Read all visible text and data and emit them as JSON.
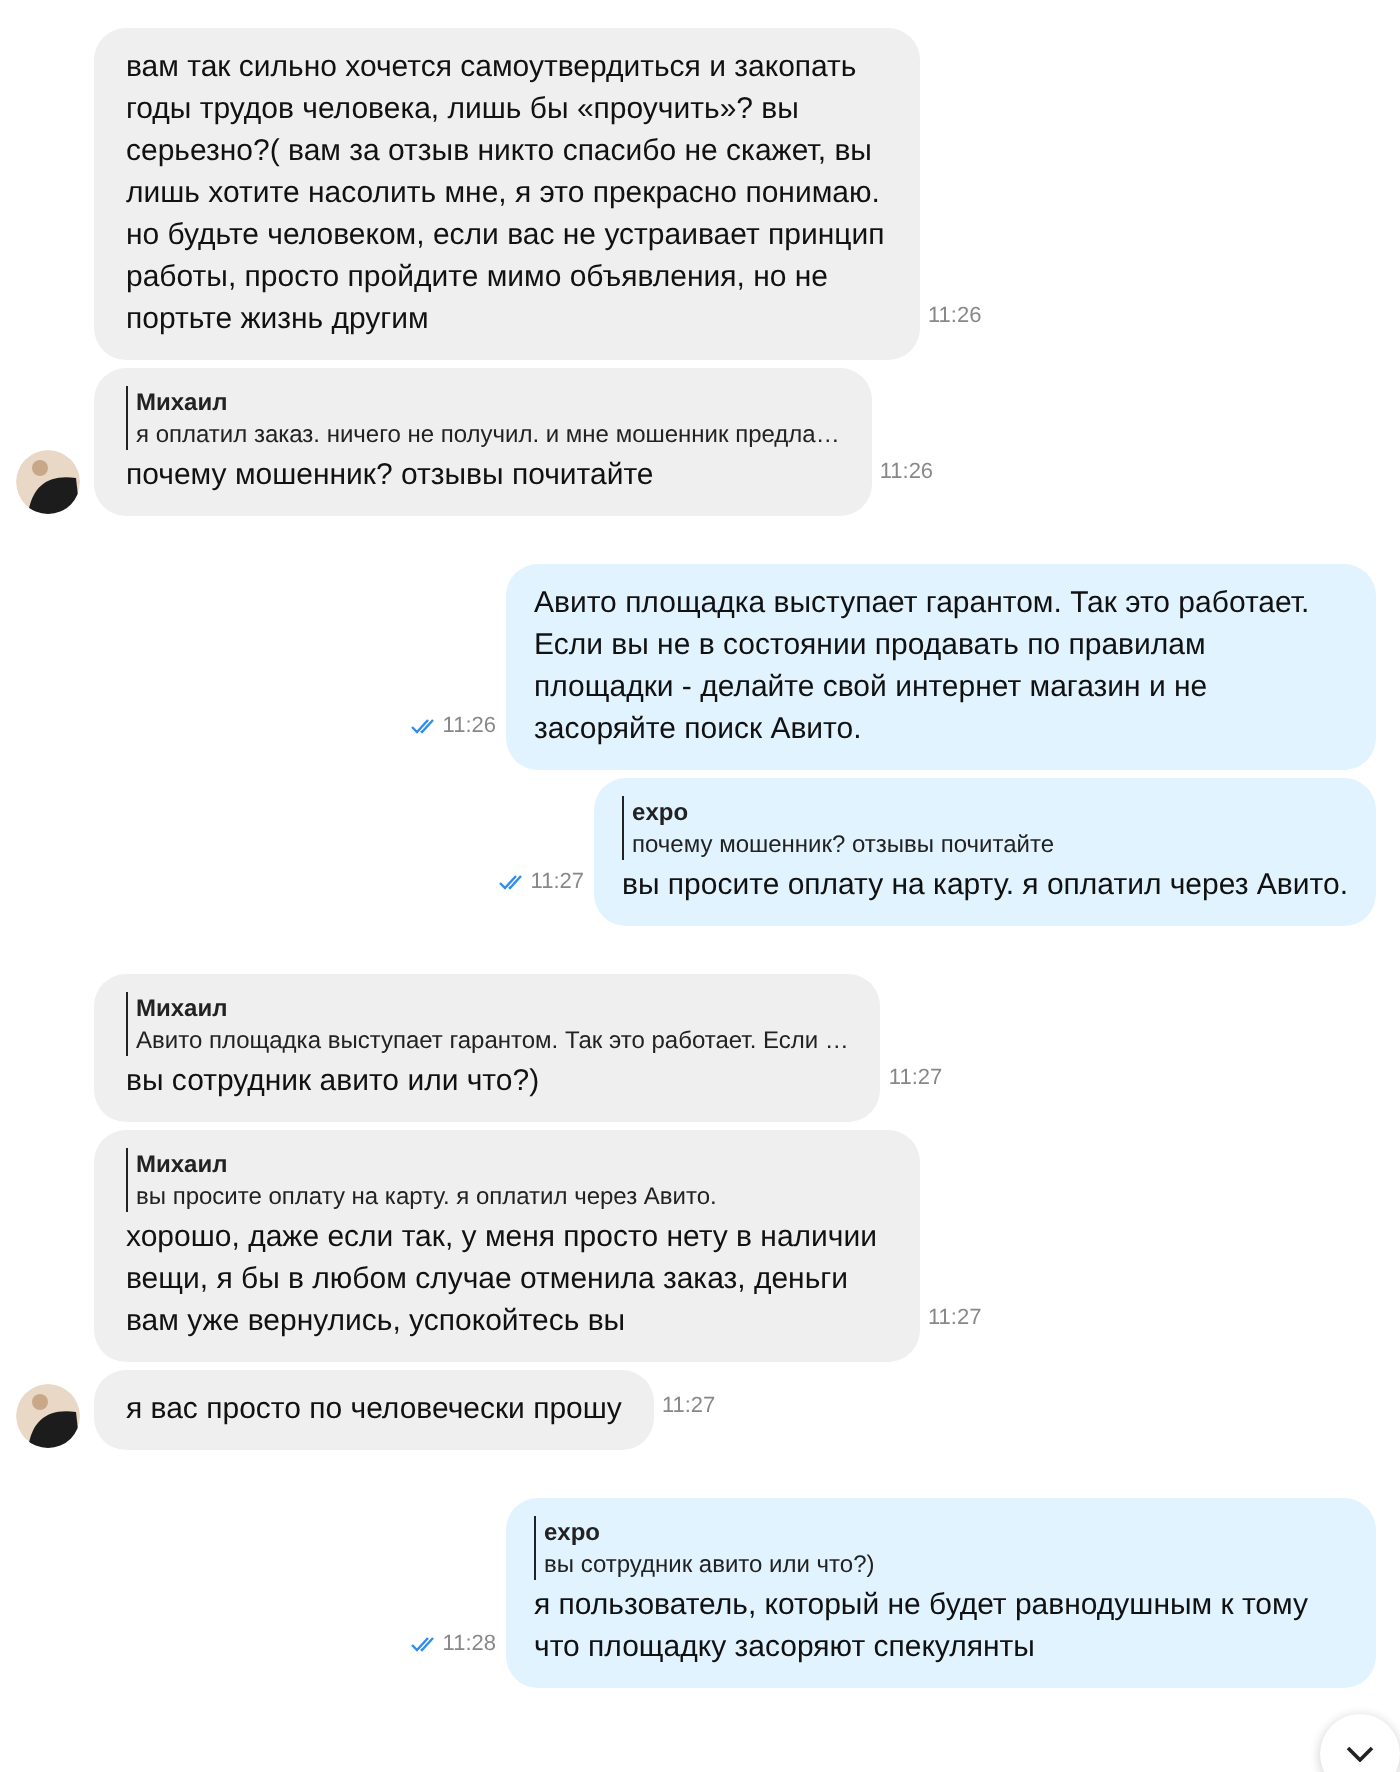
{
  "messages": [
    {
      "kind": "in",
      "avatar": false,
      "text": "вам так сильно хочется самоутвердиться и закопать годы трудов человека, лишь бы «проучить»? вы серьезно?( вам за отзыв никто спасибо не скажет, вы лишь хотите насолить мне, я это прекрасно понимаю. но будьте человеком, если вас не устраивает принцип работы, просто пройдите мимо объявления, но не портьте жизнь другим",
      "time": "11:26"
    },
    {
      "kind": "in",
      "avatar": true,
      "quote": {
        "author": "Михаил",
        "text": "я оплатил заказ. ничего не получил. и мне мошенник предла…"
      },
      "text": "почему мошенник? отзывы почитайте",
      "time": "11:26"
    },
    {
      "kind": "out",
      "read": true,
      "text": "Авито площадка выступает гарантом. Так это работает. Если вы не в состоянии продавать по правилам площадки - делайте свой интернет магазин и не засоряйте поиск Авито.",
      "time": "11:26"
    },
    {
      "kind": "out",
      "read": true,
      "quote": {
        "author": "expo",
        "text": "почему мошенник? отзывы почитайте"
      },
      "text": "вы просите оплату на карту. я оплатил через Авито.",
      "time": "11:27"
    },
    {
      "kind": "in",
      "avatar": false,
      "quote": {
        "author": "Михаил",
        "text": "Авито площадка выступает гарантом. Так это работает. Если …"
      },
      "text": "вы сотрудник авито или что?)",
      "time": "11:27"
    },
    {
      "kind": "in",
      "avatar": false,
      "quote": {
        "author": "Михаил",
        "text": "вы просите оплату на карту. я оплатил через Авито."
      },
      "text": "хорошо, даже если так, у меня просто нету в наличии вещи, я бы в любом случае отменила заказ, деньги вам уже вернулись, успокойтесь вы",
      "time": "11:27"
    },
    {
      "kind": "in",
      "avatar": true,
      "text": "я вас просто по человечески прошу",
      "time": "11:27"
    },
    {
      "kind": "out",
      "read": true,
      "quote": {
        "author": "expo",
        "text": "вы сотрудник авито или что?)"
      },
      "text": "я пользователь, который не будет равнодушным к тому что площадку засоряют спекулянты",
      "time": "11:28"
    }
  ]
}
